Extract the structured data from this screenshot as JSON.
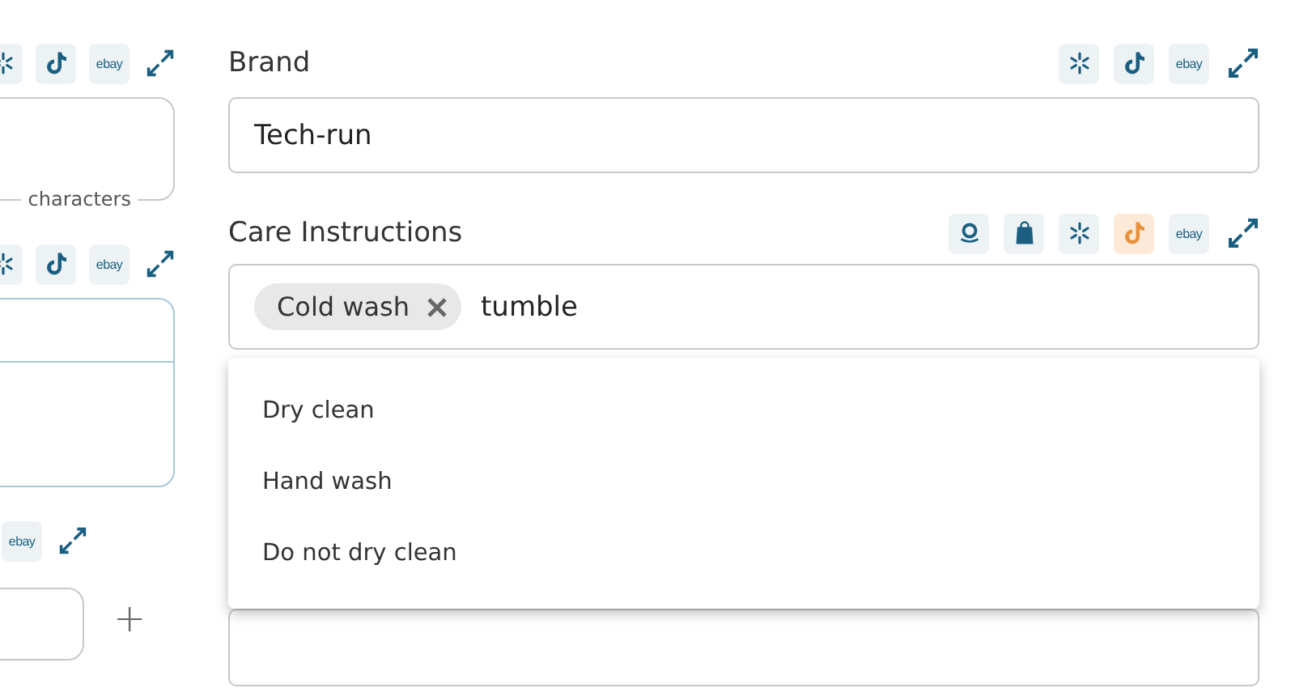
{
  "left_fields": [
    {
      "kind": "textarea",
      "marketplaces": [
        {
          "kind": "walmart",
          "highlighted": false
        },
        {
          "kind": "tiktok",
          "highlighted": false
        },
        {
          "kind": "ebay",
          "label": "ebay",
          "highlighted": false
        }
      ],
      "helper": "characters"
    },
    {
      "kind": "table",
      "marketplaces": [
        {
          "kind": "walmart",
          "highlighted": false
        },
        {
          "kind": "tiktok",
          "highlighted": false
        },
        {
          "kind": "ebay",
          "label": "ebay",
          "highlighted": false
        }
      ]
    },
    {
      "kind": "input_add",
      "marketplaces": [
        {
          "kind": "ebay",
          "label": "ebay",
          "highlighted": false
        }
      ],
      "add_label": "+"
    }
  ],
  "brand": {
    "label": "Brand",
    "value": "Tech-run",
    "marketplaces": [
      {
        "kind": "walmart",
        "highlighted": false
      },
      {
        "kind": "tiktok",
        "highlighted": false
      },
      {
        "kind": "ebay",
        "label": "ebay",
        "highlighted": false
      }
    ]
  },
  "care": {
    "label": "Care Instructions",
    "marketplaces": [
      {
        "kind": "amazon",
        "highlighted": false
      },
      {
        "kind": "shopify",
        "highlighted": false
      },
      {
        "kind": "walmart",
        "highlighted": false
      },
      {
        "kind": "tiktok",
        "highlighted": true
      },
      {
        "kind": "ebay",
        "label": "ebay",
        "highlighted": false
      }
    ],
    "chips": [
      "Cold wash"
    ],
    "value": "tumble",
    "options": [
      "Dry clean",
      "Hand wash",
      "Do not dry clean"
    ]
  }
}
